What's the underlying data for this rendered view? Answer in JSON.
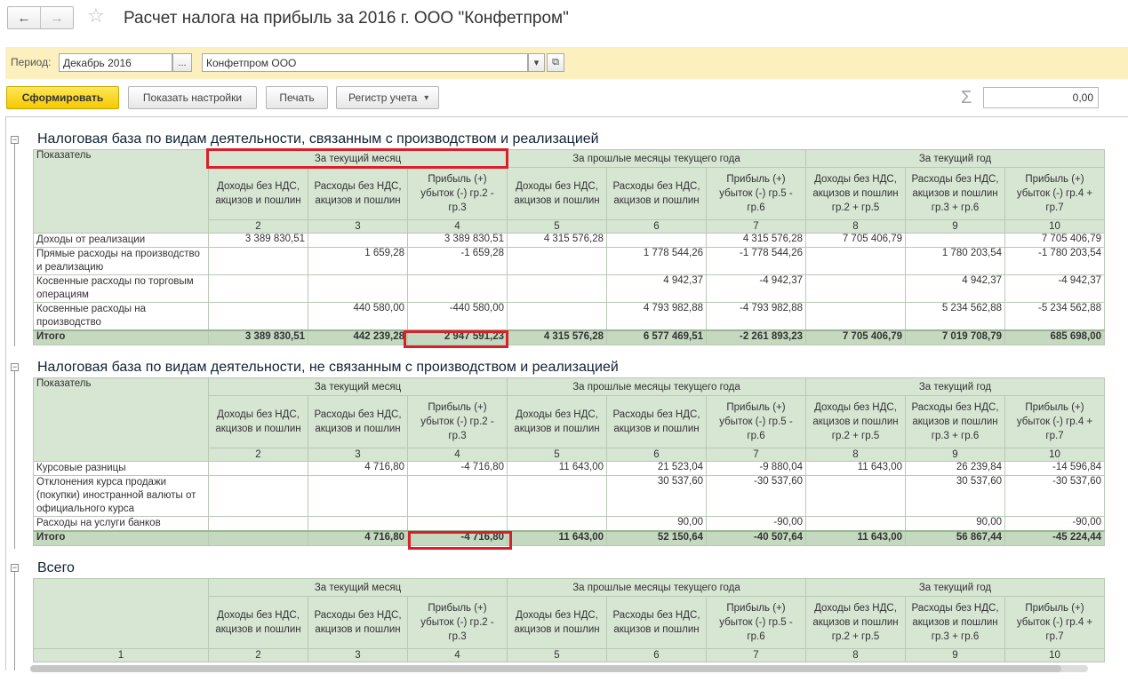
{
  "window": {
    "title": "Расчет налога на прибыль за 2016 г. ООО \"Конфетпром\"",
    "back_glyph": "←",
    "forward_glyph": "→",
    "favorite_glyph": "☆"
  },
  "period": {
    "label": "Период:",
    "value": "Декабрь 2016",
    "select_btn": "...",
    "org": "Конфетпром ООО",
    "org_dropdown": "▾",
    "org_open": "⧉"
  },
  "toolbar": {
    "generate": "Сформировать",
    "show_settings": "Показать настройки",
    "print": "Печать",
    "register": "Регистр учета",
    "register_arrow": "▾",
    "sigma": "Σ",
    "sum_value": "0,00"
  },
  "headers": {
    "indicator": "Показатель",
    "groups": [
      "За текущий месяц",
      "За прошлые месяцы текущего года",
      "За текущий год"
    ],
    "cols": [
      "Доходы без НДС, акцизов и пошлин",
      "Расходы без НДС, акцизов и пошлин",
      "Прибыль (+) убыток (-) гр.2 - гр.3",
      "Доходы без НДС, акцизов и пошлин",
      "Расходы без НДС, акцизов и пошлин",
      "Прибыль (+) убыток (-) гр.5 - гр.6",
      "Доходы без НДС, акцизов и пошлин гр.2 + гр.5",
      "Расходы без НДС, акцизов и пошлин гр.3 + гр.6",
      "Прибыль (+) убыток (-) гр.4 + гр.7"
    ],
    "numbers": [
      "1",
      "2",
      "3",
      "4",
      "5",
      "6",
      "7",
      "8",
      "9",
      "10"
    ]
  },
  "sections": [
    {
      "title": "Налоговая база по видам деятельности, связанным с производством и реализацией",
      "rows": [
        {
          "label": "Доходы от реализации",
          "values": [
            "3 389 830,51",
            "",
            "3 389 830,51",
            "4 315 576,28",
            "",
            "4 315 576,28",
            "7 705 406,79",
            "",
            "7 705 406,79"
          ]
        },
        {
          "label": "Прямые расходы на производство и реализацию",
          "values": [
            "",
            "1 659,28",
            "-1 659,28",
            "",
            "1 778 544,26",
            "-1 778 544,26",
            "",
            "1 780 203,54",
            "-1 780 203,54"
          ]
        },
        {
          "label": "Косвенные расходы по торговым операциям",
          "values": [
            "",
            "",
            "",
            "",
            "4 942,37",
            "-4 942,37",
            "",
            "4 942,37",
            "-4 942,37"
          ]
        },
        {
          "label": "Косвенные расходы на производство",
          "values": [
            "",
            "440 580,00",
            "-440 580,00",
            "",
            "4 793 982,88",
            "-4 793 982,88",
            "",
            "5 234 562,88",
            "-5 234 562,88"
          ]
        }
      ],
      "total": {
        "label": "Итого",
        "values": [
          "3 389 830,51",
          "442 239,28",
          "2 947 591,23",
          "4 315 576,28",
          "6 577 469,51",
          "-2 261 893,23",
          "7 705 406,79",
          "7 019 708,79",
          "685 698,00"
        ]
      }
    },
    {
      "title": "Налоговая база по видам деятельности, не связанным с производством и реализацией",
      "rows": [
        {
          "label": "Курсовые разницы",
          "values": [
            "",
            "4 716,80",
            "-4 716,80",
            "11 643,00",
            "21 523,04",
            "-9 880,04",
            "11 643,00",
            "26 239,84",
            "-14 596,84"
          ]
        },
        {
          "label": "Отклонения курса продажи (покупки) иностранной валюты от официального курса",
          "values": [
            "",
            "",
            "",
            "",
            "30 537,60",
            "-30 537,60",
            "",
            "30 537,60",
            "-30 537,60"
          ]
        },
        {
          "label": "Расходы на услуги банков",
          "values": [
            "",
            "",
            "",
            "",
            "90,00",
            "-90,00",
            "",
            "90,00",
            "-90,00"
          ]
        }
      ],
      "total": {
        "label": "Итого",
        "values": [
          "",
          "4 716,80",
          "-4 716,80",
          "11 643,00",
          "52 150,64",
          "-40 507,64",
          "11 643,00",
          "56 867,44",
          "-45 224,44"
        ]
      }
    },
    {
      "title": "Всего"
    }
  ]
}
